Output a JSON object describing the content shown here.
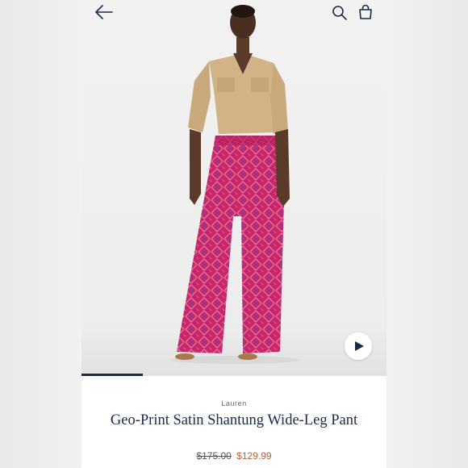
{
  "product": {
    "brand": "Lauren",
    "title": "Geo-Print Satin Shantung Wide-Leg Pant",
    "original_price": "$175.00",
    "sale_price": "$129.99",
    "image_alt": "Model wearing tan shirt and pink geo-print wide-leg pants"
  },
  "gallery": {
    "progress": 0.2
  },
  "icons": {
    "back": "arrow-left-icon",
    "search": "search-icon",
    "bag": "shopping-bag-icon",
    "play": "play-icon"
  },
  "colors": {
    "navy": "#1b2a4a",
    "sale": "#b8623a",
    "pant_pink": "#c8286a",
    "shirt_tan": "#d2b387"
  }
}
